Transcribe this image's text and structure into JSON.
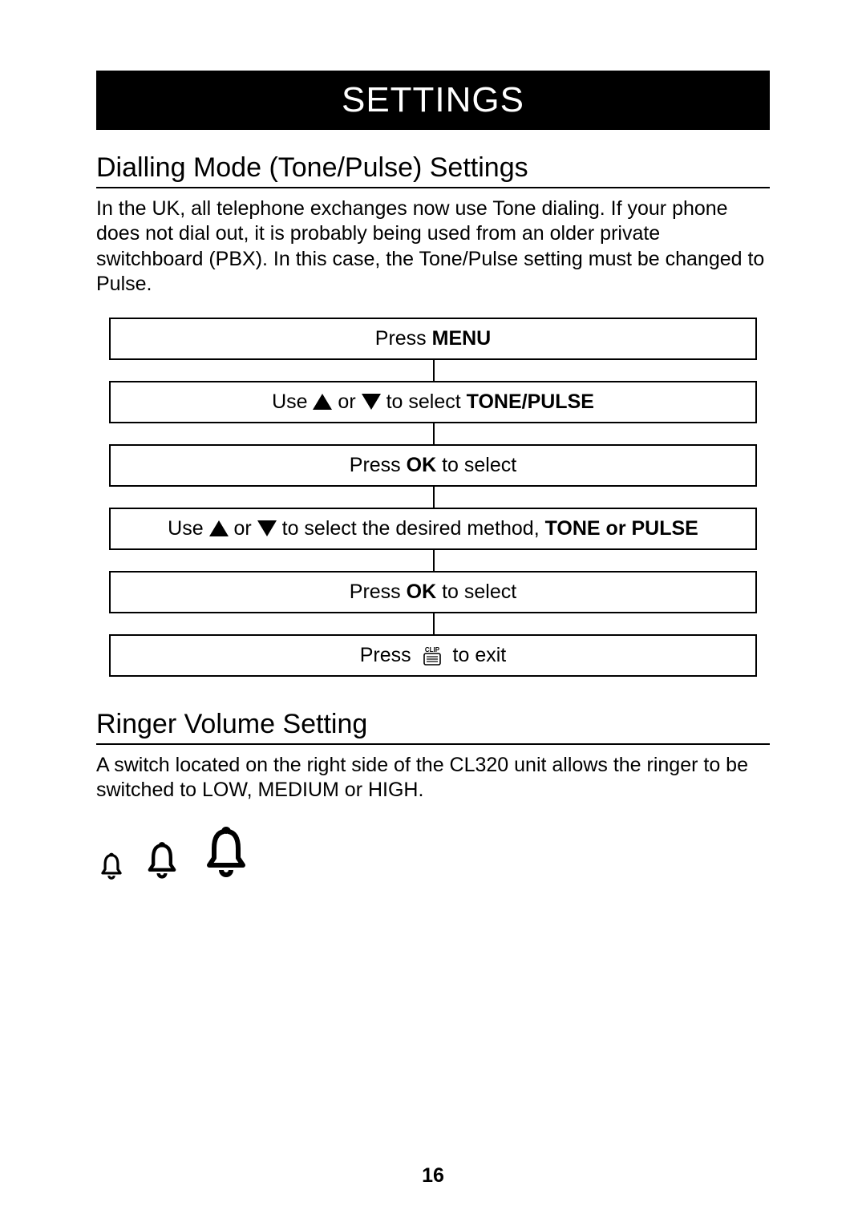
{
  "header": "SETTINGS",
  "section1": {
    "title": "Dialling Mode (Tone/Pulse) Settings",
    "paragraph": "In the UK, all telephone exchanges now use Tone dialing.  If your phone does not dial out, it is probably being used from an older private switchboard (PBX). In this case, the Tone/Pulse setting must be changed to Pulse."
  },
  "flow": {
    "step1": {
      "t1": "Press ",
      "b1": "MENU"
    },
    "step2": {
      "t1": "Use ",
      "t2": " or ",
      "t3": " to select ",
      "b1": "TONE/PULSE"
    },
    "step3": {
      "t1": "Press ",
      "b1": "OK",
      "t2": " to select"
    },
    "step4": {
      "t1": "Use ",
      "t2": " or",
      "t3": " to select  the desired method, ",
      "b1": "TONE or PULSE"
    },
    "step5": {
      "t1": "Press ",
      "b1": "OK",
      "t2": " to select"
    },
    "step6": {
      "t1": "Press ",
      "t2": "  to exit"
    }
  },
  "section2": {
    "title": "Ringer Volume Setting",
    "paragraph": "A switch located on the right side of the CL320 unit allows the ringer to be switched to LOW, MEDIUM or HIGH."
  },
  "page_number": "16",
  "icons": {
    "up": "triangle-up-icon",
    "down": "triangle-down-icon",
    "clip": "clip-card-icon",
    "bell_small": "bell-small-icon",
    "bell_medium": "bell-medium-icon",
    "bell_large": "bell-large-icon"
  }
}
